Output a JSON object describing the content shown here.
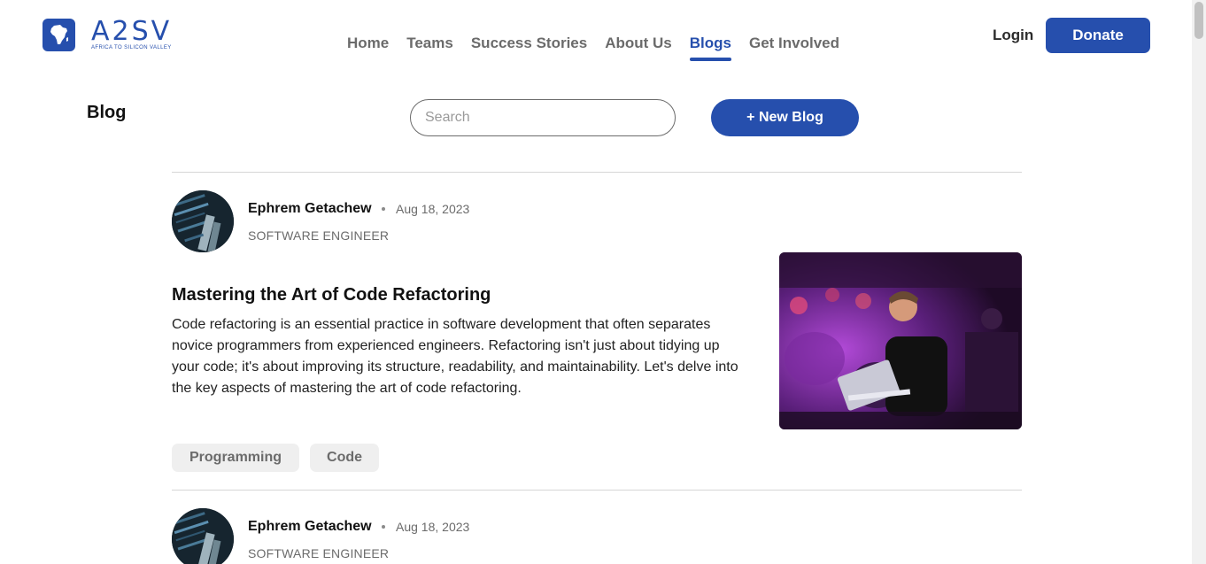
{
  "brand": {
    "wordmark": "A2SV",
    "tagline": "AFRICA TO SILICON VALLEY"
  },
  "nav": {
    "items": [
      {
        "label": "Home",
        "active": false
      },
      {
        "label": "Teams",
        "active": false
      },
      {
        "label": "Success Stories",
        "active": false
      },
      {
        "label": "About Us",
        "active": false
      },
      {
        "label": "Blogs",
        "active": true
      },
      {
        "label": "Get Involved",
        "active": false
      }
    ],
    "login_label": "Login",
    "donate_label": "Donate"
  },
  "page": {
    "title": "Blog",
    "search_placeholder": "Search",
    "new_blog_label": "+ New Blog"
  },
  "posts": [
    {
      "author": "Ephrem Getachew",
      "date": "Aug 18, 2023",
      "role": "SOFTWARE ENGINEER",
      "title": "Mastering the Art of Code Refactoring",
      "excerpt": "Code refactoring is an essential practice in software development that often separates novice programmers from experienced engineers. Refactoring isn't just about tidying up your code; it's about improving its structure, readability, and maintainability. Let's delve into the key aspects of mastering the art of code refactoring.",
      "tags": [
        "Programming",
        "Code"
      ]
    },
    {
      "author": "Ephrem Getachew",
      "date": "Aug 18, 2023",
      "role": "SOFTWARE ENGINEER"
    }
  ],
  "colors": {
    "accent": "#264fad",
    "muted_text": "#6b6b6b",
    "tag_bg": "#efefef"
  }
}
